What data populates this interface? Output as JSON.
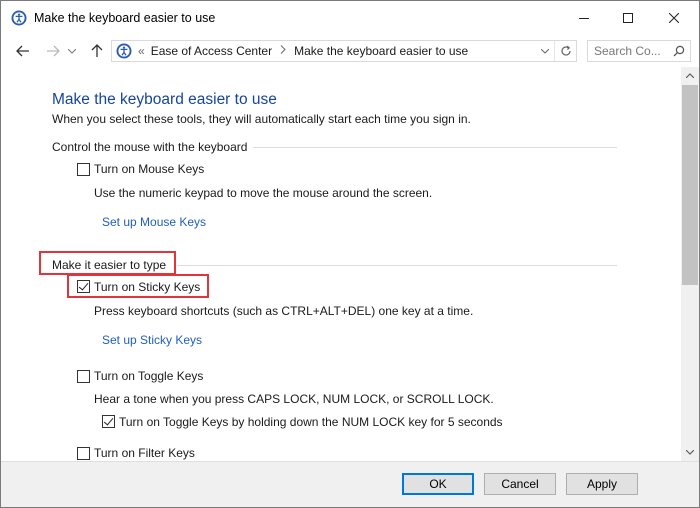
{
  "window": {
    "title": "Make the keyboard easier to use",
    "icon": "ease-of-access-icon"
  },
  "address": {
    "chevron": "«",
    "breadcrumb": [
      "Ease of Access Center",
      "Make the keyboard easier to use"
    ],
    "search_placeholder": "Search Co..."
  },
  "page": {
    "title": "Make the keyboard easier to use",
    "description": "When you select these tools, they will automatically start each time you sign in."
  },
  "sections": {
    "mouse": {
      "heading": "Control the mouse with the keyboard",
      "mouse_keys": {
        "label": "Turn on Mouse Keys",
        "checked": false,
        "description": "Use the numeric keypad to move the mouse around the screen.",
        "link": "Set up Mouse Keys"
      }
    },
    "typing": {
      "heading": "Make it easier to type",
      "sticky_keys": {
        "label": "Turn on Sticky Keys",
        "checked": true,
        "description": "Press keyboard shortcuts (such as CTRL+ALT+DEL) one key at a time.",
        "link": "Set up Sticky Keys"
      },
      "toggle_keys": {
        "label": "Turn on Toggle Keys",
        "checked": false,
        "description": "Hear a tone when you press CAPS LOCK, NUM LOCK, or SCROLL LOCK.",
        "sub_option": {
          "label": "Turn on Toggle Keys by holding down the NUM LOCK key for 5 seconds",
          "checked": true
        }
      },
      "filter_keys": {
        "label": "Turn on Filter Keys",
        "checked": false
      }
    }
  },
  "footer": {
    "ok": "OK",
    "cancel": "Cancel",
    "apply": "Apply"
  },
  "colors": {
    "title_blue": "#16449d",
    "link_blue": "#1f5fbf",
    "highlight_red": "#e0353b"
  }
}
